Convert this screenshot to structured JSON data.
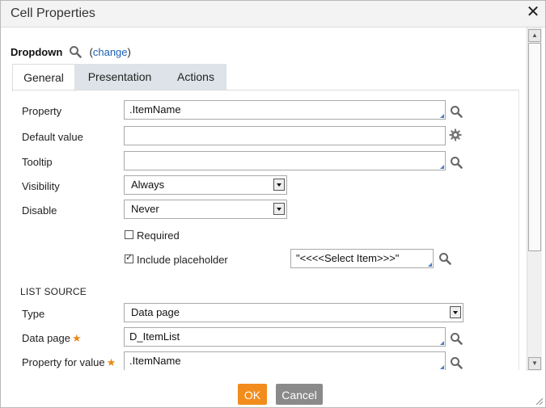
{
  "dialog": {
    "title": "Cell Properties"
  },
  "header": {
    "control_type": "Dropdown",
    "change_open": "(",
    "change_label": "change",
    "change_close": ")"
  },
  "tabs": [
    {
      "label": "General",
      "active": true
    },
    {
      "label": "Presentation",
      "active": false
    },
    {
      "label": "Actions",
      "active": false
    }
  ],
  "general": {
    "property_label": "Property",
    "property_value": ".ItemName",
    "default_value_label": "Default value",
    "default_value": "",
    "tooltip_label": "Tooltip",
    "tooltip_value": "",
    "visibility_label": "Visibility",
    "visibility_value": "Always",
    "disable_label": "Disable",
    "disable_value": "Never",
    "required_label": "Required",
    "required_checked": false,
    "include_placeholder_label": "Include placeholder",
    "include_placeholder_checked": true,
    "placeholder_value": "\"<<<<Select Item>>>\""
  },
  "list_source": {
    "heading": "LIST SOURCE",
    "type_label": "Type",
    "type_value": "Data page",
    "data_page_label": "Data page",
    "data_page_value": "D_ItemList",
    "property_for_value_label": "Property for value",
    "property_for_value_value": ".ItemName",
    "required_marker": "★"
  },
  "footer": {
    "ok_label": "OK",
    "cancel_label": "Cancel"
  },
  "colors": {
    "accent_orange": "#f28c1c",
    "cancel_gray": "#8a8a8a",
    "link_blue": "#1a5fb4",
    "tab_inactive": "#dde3e8"
  }
}
